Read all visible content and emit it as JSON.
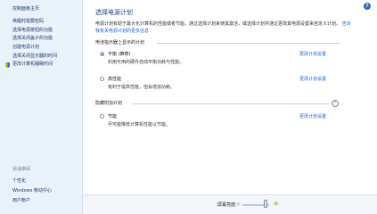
{
  "sidebar": {
    "home": "控制面板主页",
    "items": [
      {
        "label": "唤醒时需要密码",
        "shield": false
      },
      {
        "label": "选择电源按钮的功能",
        "shield": false
      },
      {
        "label": "选择关闭盖子的功能",
        "shield": false
      },
      {
        "label": "创建电源计划",
        "shield": false
      },
      {
        "label": "选择关闭显示器的时间",
        "shield": false
      },
      {
        "label": "更改计算机睡眠时间",
        "shield": true
      }
    ],
    "see_also_label": "另请参阅",
    "see_also": [
      "个性化",
      "Windows 移动中心",
      "用户帐户"
    ]
  },
  "help_icon": "?",
  "main": {
    "title": "选择电源计划",
    "desc_text": "电源计划有助于最大化计算机的性能或者节能。通过选择计划来使其激活，或选择计划并通过更改其电源设置来自定义计划。",
    "desc_link": "告诉我有关电源计划的更多信息",
    "group1_header": "电池指示器上显示的计划",
    "plans_shown": [
      {
        "name": "平衡 (推荐)",
        "desc": "利用可用的硬件自动平衡功耗与性能。",
        "link": "更改计划设置",
        "selected": true
      },
      {
        "name": "高性能",
        "desc": "有利于提高性能，但会增加功耗。",
        "link": "更改计划设置",
        "selected": false
      }
    ],
    "group2_header": "隐藏附加计划",
    "collapse_glyph": "⌃",
    "plans_hidden": [
      {
        "name": "节能",
        "desc": "尽可能降低计算机性能以节能。",
        "link": "更改计划设置",
        "selected": false
      }
    ]
  },
  "brightness": {
    "label": "屏幕亮度:",
    "sun_small": "☼",
    "sun_big": "☀",
    "level": 0.85
  }
}
